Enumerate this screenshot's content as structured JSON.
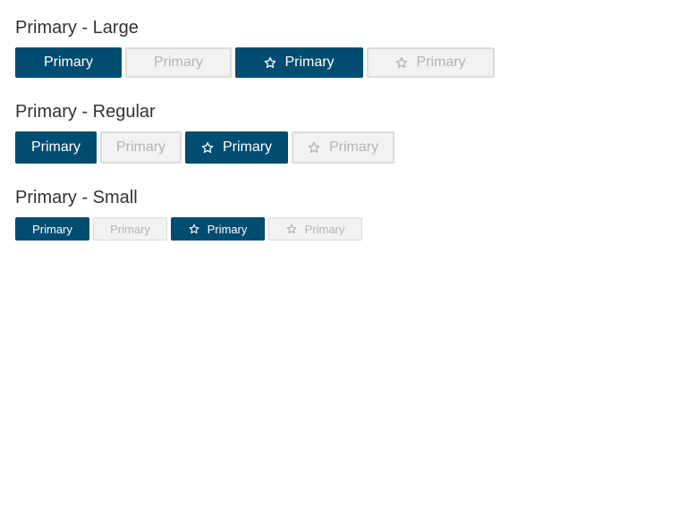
{
  "colors": {
    "primary": "#004d71",
    "primary_text": "#ffffff",
    "disabled_bg": "#f2f2f2",
    "disabled_border": "#dcdcdc",
    "disabled_text": "#b4b4b4",
    "heading_text": "#333333"
  },
  "sections": [
    {
      "title": "Primary - Large",
      "buttons": [
        {
          "label": "Primary",
          "state": "enabled",
          "icon": null
        },
        {
          "label": "Primary",
          "state": "disabled",
          "icon": null
        },
        {
          "label": "Primary",
          "state": "enabled",
          "icon": "star-outline-icon"
        },
        {
          "label": "Primary",
          "state": "disabled",
          "icon": "star-outline-icon"
        }
      ]
    },
    {
      "title": "Primary - Regular",
      "buttons": [
        {
          "label": "Primary",
          "state": "enabled",
          "icon": null
        },
        {
          "label": "Primary",
          "state": "disabled",
          "icon": null
        },
        {
          "label": "Primary",
          "state": "enabled",
          "icon": "star-outline-icon"
        },
        {
          "label": "Primary",
          "state": "disabled",
          "icon": "star-outline-icon"
        }
      ]
    },
    {
      "title": "Primary - Small",
      "buttons": [
        {
          "label": "Primary",
          "state": "enabled",
          "icon": null
        },
        {
          "label": "Primary",
          "state": "disabled",
          "icon": null
        },
        {
          "label": "Primary",
          "state": "enabled",
          "icon": "star-outline-icon"
        },
        {
          "label": "Primary",
          "state": "disabled",
          "icon": "star-outline-icon"
        }
      ]
    }
  ]
}
